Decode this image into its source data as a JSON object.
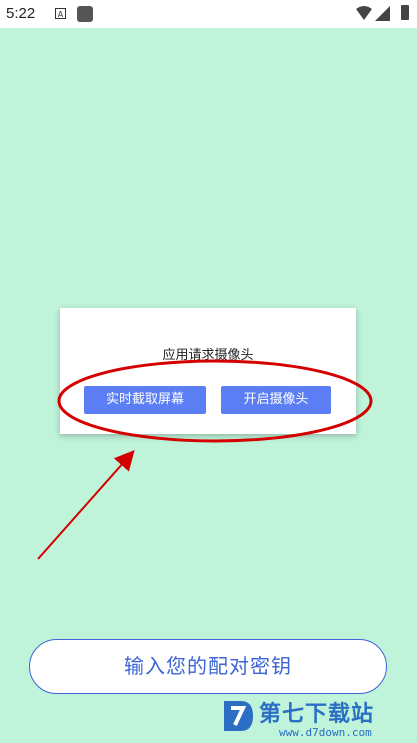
{
  "status_bar": {
    "time": "5:22",
    "notification_letter": "A"
  },
  "dialog": {
    "title": "应用请求摄像头",
    "buttons": [
      {
        "label": "实时截取屏幕"
      },
      {
        "label": "开启摄像头"
      }
    ]
  },
  "pair_key_button": {
    "label": "输入您的配对密钥"
  },
  "watermark": {
    "brand": "第七下载站",
    "url": "www.d7down.com"
  },
  "colors": {
    "background": "#bff3da",
    "primary_button": "#5b7ef5",
    "outline_blue": "#3d63d6",
    "annotation_red": "#d40000"
  },
  "icons": [
    "wifi-icon",
    "signal-icon",
    "battery-icon"
  ]
}
